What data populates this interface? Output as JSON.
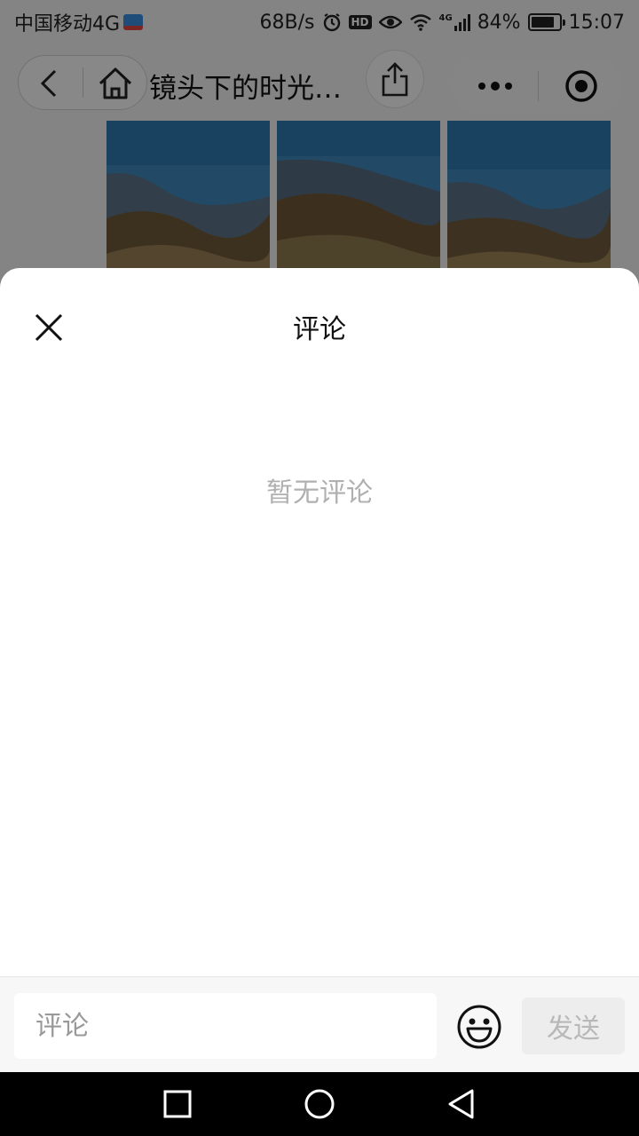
{
  "status_bar": {
    "carrier": "中国移动4G",
    "speed": "68B/s",
    "hd": "HD",
    "network": "4G",
    "battery_percent": "84%",
    "battery_level": 0.84,
    "time": "15:07",
    "icons": [
      "alarm-icon",
      "eye-icon",
      "wifi-icon",
      "signal-icon",
      "battery-icon"
    ]
  },
  "nav": {
    "title": "镜头下的时光…",
    "icons": [
      "back-icon",
      "home-icon",
      "share-icon",
      "more-icon",
      "target-icon"
    ]
  },
  "sheet": {
    "title": "评论",
    "empty_text": "暂无评论",
    "input_placeholder": "评论",
    "send_label": "发送",
    "icons": [
      "close-icon",
      "emoji-icon"
    ]
  },
  "system_nav": {
    "icons": [
      "recents-icon",
      "home-circle-icon",
      "back-triangle-icon"
    ]
  },
  "colors": {
    "sheet_background": "#ffffff",
    "empty_text": "#b0b0b0",
    "send_disabled_bg": "#ededed",
    "send_disabled_text": "#b8b8b8",
    "system_nav_bg": "#000000"
  }
}
